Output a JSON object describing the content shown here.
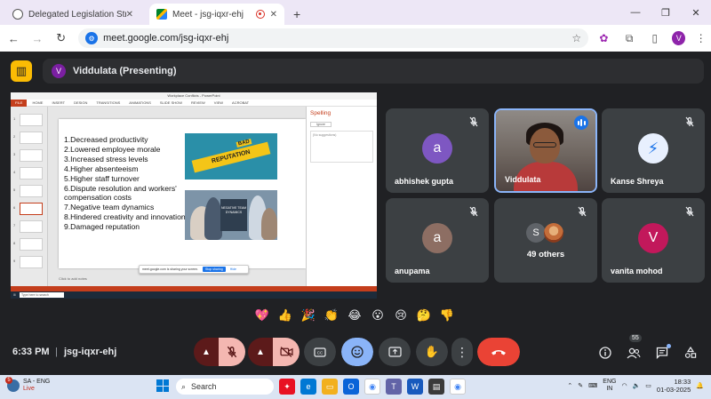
{
  "browser": {
    "tabs": [
      {
        "title": "Delegated Legislation Structure",
        "active": false
      },
      {
        "title": "Meet - jsg-iqxr-ehj",
        "active": true
      }
    ],
    "new_tab": "+",
    "url": "meet.google.com/jsg-iqxr-ehj",
    "profile_initial": "V"
  },
  "meet": {
    "presenting_initial": "V",
    "presenting_text": "Viddulata (Presenting)",
    "clock": "6:33 PM",
    "separator": "|",
    "meeting_code": "jsg-iqxr-ehj",
    "participants_count": "55"
  },
  "shared_slide": {
    "app_title": "Workplace Conflicts - PowerPoint",
    "ribbon_file": "FILE",
    "ribbon_tabs": [
      "HOME",
      "INSERT",
      "DESIGN",
      "TRANSITIONS",
      "ANIMATIONS",
      "SLIDE SHOW",
      "REVIEW",
      "VIEW",
      "ACROBAT"
    ],
    "points": [
      "1.Decreased productivity",
      "2.Lowered employee morale",
      "3.Increased stress levels",
      "4.Higher absenteeism",
      "5.Higher staff turnover",
      "6.Dispute resolution and workers' compensation costs",
      "7.Negative team dynamics",
      "8.Hindered creativity and innovation",
      "9.Damaged reputation"
    ],
    "image1_text": "REPUTATION",
    "image1_small": "BAD",
    "image2_text": "NEGATIVE TEAM DYNAMICS",
    "spelling_title": "Spelling",
    "spelling_ignore": "Ignore",
    "spelling_hint": "(No suggestions)",
    "notes": "Click to add notes",
    "share_msg": "meet.google.com is sharing your screen.",
    "share_stop": "Stop sharing",
    "share_hide": "Hide",
    "thumb_numbers": [
      "1",
      "2",
      "3",
      "4",
      "5",
      "6",
      "7",
      "8",
      "9"
    ],
    "mini_search": "Type here to search"
  },
  "tiles": [
    {
      "name": "abhishek gupta",
      "initial": "a",
      "color": "#7e57c2",
      "muted": true
    },
    {
      "name": "Viddulata",
      "video": true,
      "speaking": true
    },
    {
      "name": "Kanse Shreya",
      "muted": true
    },
    {
      "name": "anupama",
      "initial": "a",
      "color": "#8d6e63",
      "muted": true
    },
    {
      "others": "49 others",
      "initial": "S",
      "muted": true
    },
    {
      "name": "vanita mohod",
      "initial": "V",
      "color": "#c2185b",
      "muted": true
    }
  ],
  "reactions": [
    "💖",
    "👍",
    "🎉",
    "👏",
    "😂",
    "😮",
    "😢",
    "🤔",
    "👎"
  ],
  "taskbar": {
    "weather_line1": "SA - ENG",
    "weather_line2": "Live",
    "badge": "5",
    "search": "Search",
    "lang1": "ENG",
    "lang2": "IN",
    "time": "18:33",
    "date": "01-03-2025"
  }
}
